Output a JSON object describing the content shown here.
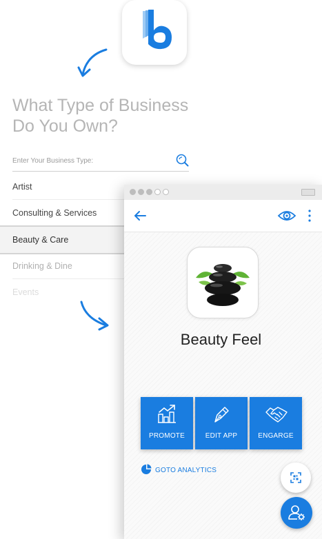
{
  "onboarding": {
    "headline": "What Type of Business Do You Own?",
    "search": {
      "placeholder": "Enter Your Business Type:",
      "value": ""
    },
    "business_types": [
      {
        "label": "Artist"
      },
      {
        "label": "Consulting & Services"
      },
      {
        "label": "Beauty & Care"
      },
      {
        "label": "Drinking & Dine"
      },
      {
        "label": "Events"
      }
    ],
    "selected": "Beauty & Care"
  },
  "preview": {
    "app_name": "Beauty Feel",
    "actions": [
      {
        "label": "PROMOTE",
        "icon": "chart-up-icon"
      },
      {
        "label": "EDIT APP",
        "icon": "pen-nib-icon"
      },
      {
        "label": "ENGARGE",
        "icon": "handshake-icon"
      }
    ],
    "analytics_link": "GOTO ANALYTICS",
    "icons": {
      "back": "arrow-left-icon",
      "preview": "eye-icon",
      "more": "more-vertical-icon",
      "scan": "qr-scan-icon",
      "account": "user-settings-icon"
    }
  },
  "colors": {
    "accent": "#1a7de0",
    "headline": "#b5b5b5",
    "text": "#444444"
  }
}
